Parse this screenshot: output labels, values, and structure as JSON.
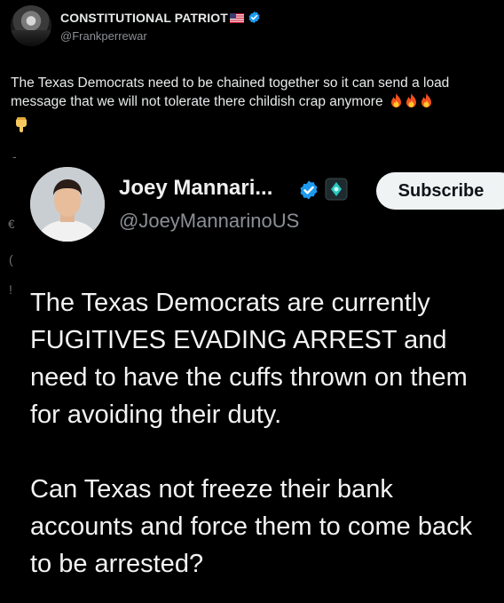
{
  "outer_post": {
    "author_name": "CONSTITUTIONAL PATRIOT",
    "author_handle": "@Frankperrewar",
    "text": "The Texas Democrats need to be chained together so it can send a load message that we will not tolerate there childish crap anymore",
    "flag_icon": "us-flag-icon",
    "verified_color": "#1d9bf0",
    "emojis": [
      "fire-icon",
      "fire-icon",
      "fire-icon",
      "pointing-down-icon"
    ]
  },
  "quoted_post": {
    "author_name": "Joey Mannari...",
    "author_handle": "@JoeyMannarinoUS",
    "subscribe_label": "Subscribe",
    "paragraphs": [
      "The Texas Democrats are currently FUGITIVES EVADING ARREST and need to have the cuffs thrown on them for avoiding their duty.",
      "Can Texas not freeze their bank accounts and force them to come back to be arrested?"
    ]
  },
  "stray_chars": [
    "-",
    "€",
    "(",
    "!"
  ]
}
